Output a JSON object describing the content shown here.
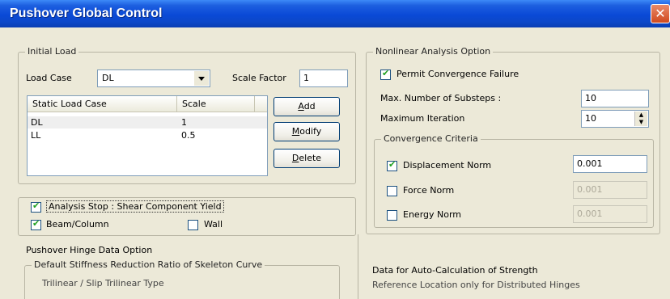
{
  "window": {
    "title": "Pushover Global Control",
    "close_glyph": "✕"
  },
  "initial_load": {
    "legend": "Initial Load",
    "load_case_label": "Load Case",
    "load_case_value": "DL",
    "scale_factor_label": "Scale Factor",
    "scale_factor_value": "1",
    "table": {
      "headers": [
        "Static Load Case",
        "Scale"
      ],
      "rows": [
        {
          "case": "DL",
          "scale": "1"
        },
        {
          "case": "LL",
          "scale": "0.5"
        }
      ]
    },
    "buttons": {
      "add": {
        "mnemonic": "A",
        "rest": "dd"
      },
      "modify": {
        "mnemonic": "M",
        "rest": "odify"
      },
      "delete": {
        "mnemonic": "D",
        "rest": "elete"
      }
    }
  },
  "analysis_stop": {
    "label": "Analysis Stop : Shear Component Yield",
    "checked": true,
    "beam_column_label": "Beam/Column",
    "beam_column_checked": true,
    "wall_label": "Wall",
    "wall_checked": false
  },
  "nonlinear": {
    "legend": "Nonlinear Analysis Option",
    "permit_label": "Permit Convergence Failure",
    "permit_checked": true,
    "substeps_label": "Max. Number of Substeps :",
    "substeps_value": "10",
    "iteration_label": "Maximum Iteration",
    "iteration_value": "10",
    "convergence": {
      "legend": "Convergence Criteria",
      "displacement_label": "Displacement Norm",
      "displacement_checked": true,
      "displacement_value": "0.001",
      "force_label": "Force Norm",
      "force_checked": false,
      "force_value": "0.001",
      "energy_label": "Energy Norm",
      "energy_checked": false,
      "energy_value": "0.001"
    }
  },
  "hinge": {
    "legend": "Pushover Hinge Data Option",
    "stiffness_legend": "Default Stiffness Reduction Ratio of Skeleton Curve",
    "stiffness_partial": "Trilinear / Slip Trilinear Type",
    "strength_legend": "Data for Auto-Calculation of Strength",
    "strength_partial": "Reference Location only for Distributed Hinges"
  }
}
